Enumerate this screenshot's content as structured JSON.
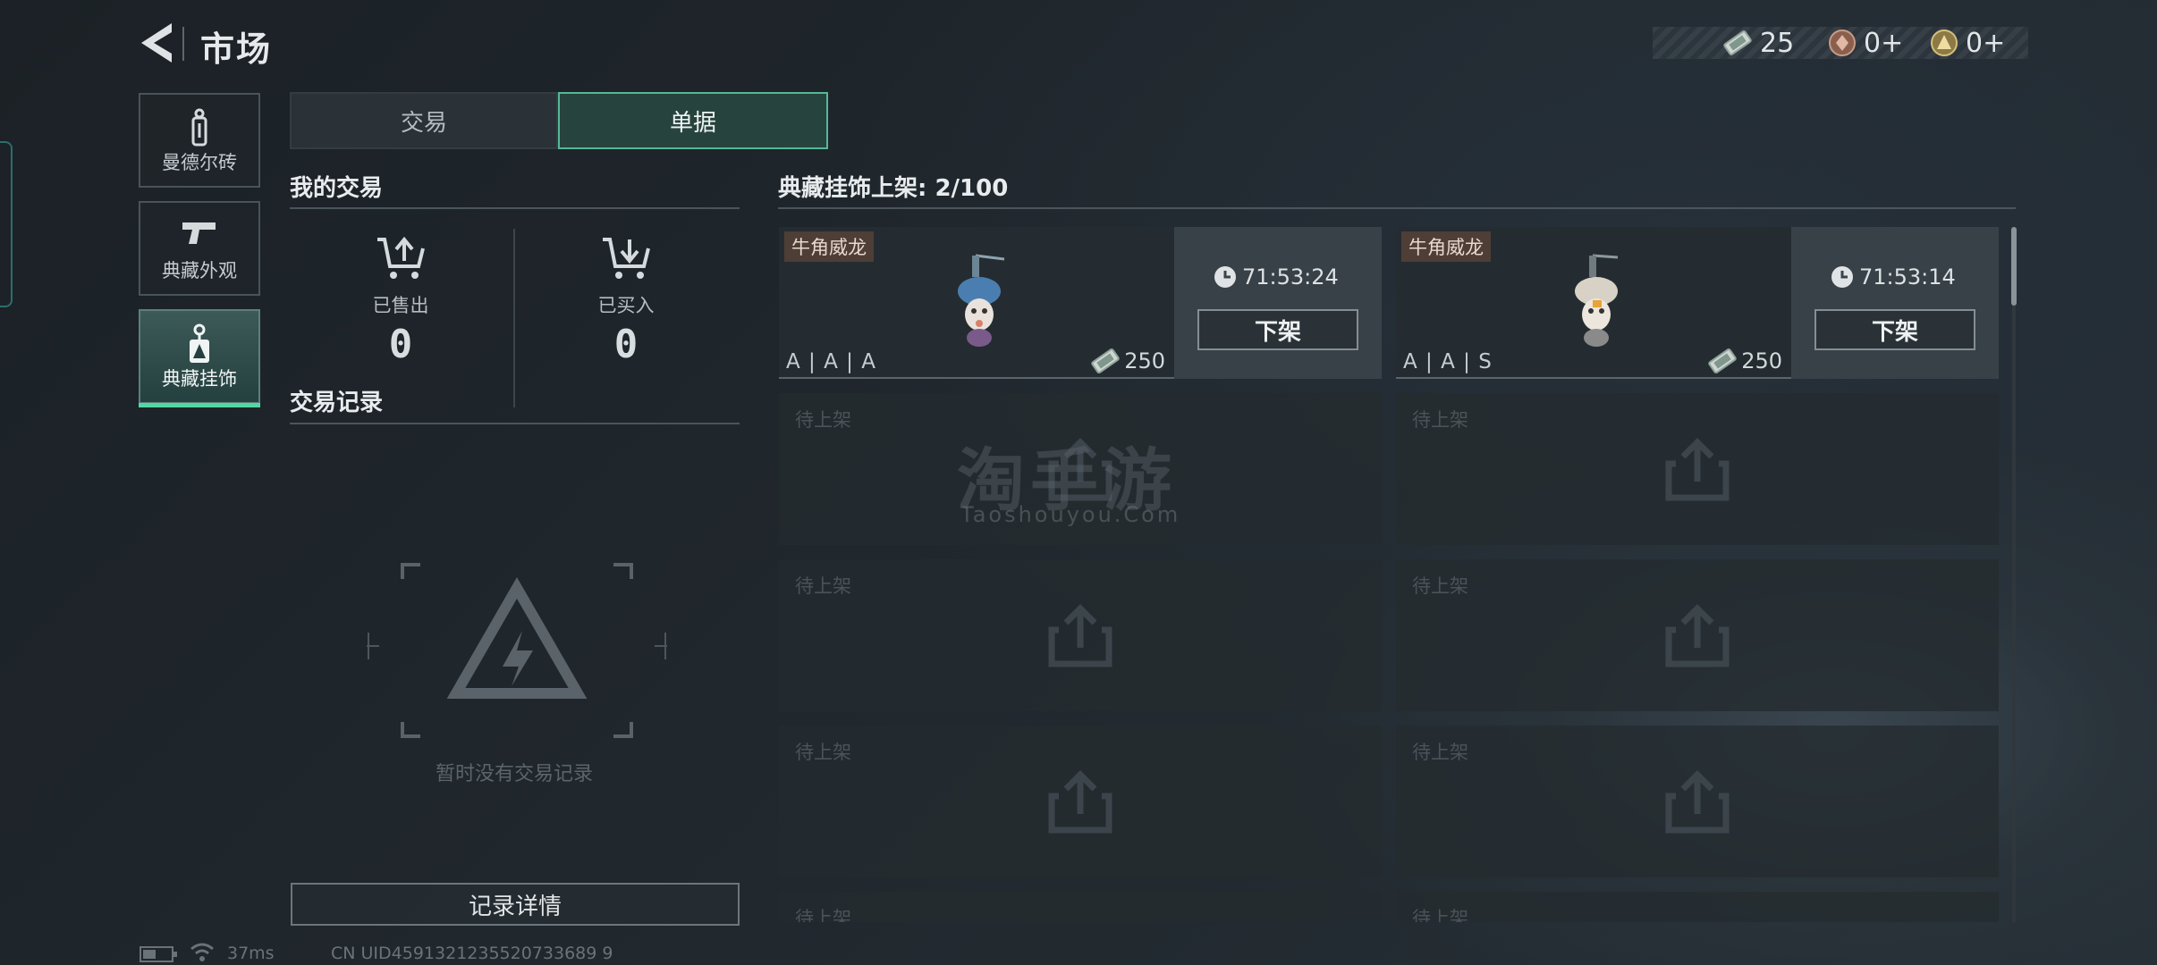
{
  "header": {
    "title": "市场"
  },
  "currencies": [
    {
      "icon": "voucher-icon",
      "value": "25"
    },
    {
      "icon": "bronze-medal-icon",
      "value": "0+"
    },
    {
      "icon": "gold-medal-icon",
      "value": "0+"
    }
  ],
  "categories": [
    {
      "label": "曼德尔砖",
      "icon": "brick-icon"
    },
    {
      "label": "典藏外观",
      "icon": "gun-icon"
    },
    {
      "label": "典藏挂饰",
      "icon": "charm-icon",
      "active": true
    }
  ],
  "tabs": [
    {
      "label": "交易",
      "active": false
    },
    {
      "label": "单据",
      "active": true
    }
  ],
  "my_trades": {
    "title": "我的交易",
    "sold_label": "已售出",
    "sold_value": "0",
    "bought_label": "已买入",
    "bought_value": "0"
  },
  "records": {
    "title": "交易记录",
    "empty_text": "暂时没有交易记录",
    "detail_button": "记录详情"
  },
  "listings": {
    "header": "典藏挂饰上架: 2/100",
    "items": [
      {
        "name": "牛角威龙",
        "grade": "A | A | A",
        "price": "250",
        "timer": "71:53:24",
        "button": "下架"
      },
      {
        "name": "牛角威龙",
        "grade": "A | A | S",
        "price": "250",
        "timer": "71:53:14",
        "button": "下架"
      }
    ],
    "pending_label": "待上架"
  },
  "watermark": {
    "main": "淘手游",
    "sub": "Taoshouyou.Com"
  },
  "status_bar": {
    "ping": "37ms",
    "uid": "CN UID4591321235520733689 9"
  },
  "colors": {
    "accent": "#54d6a4",
    "tag_bg": "#4e3e36",
    "active_tab": "#27433e"
  }
}
